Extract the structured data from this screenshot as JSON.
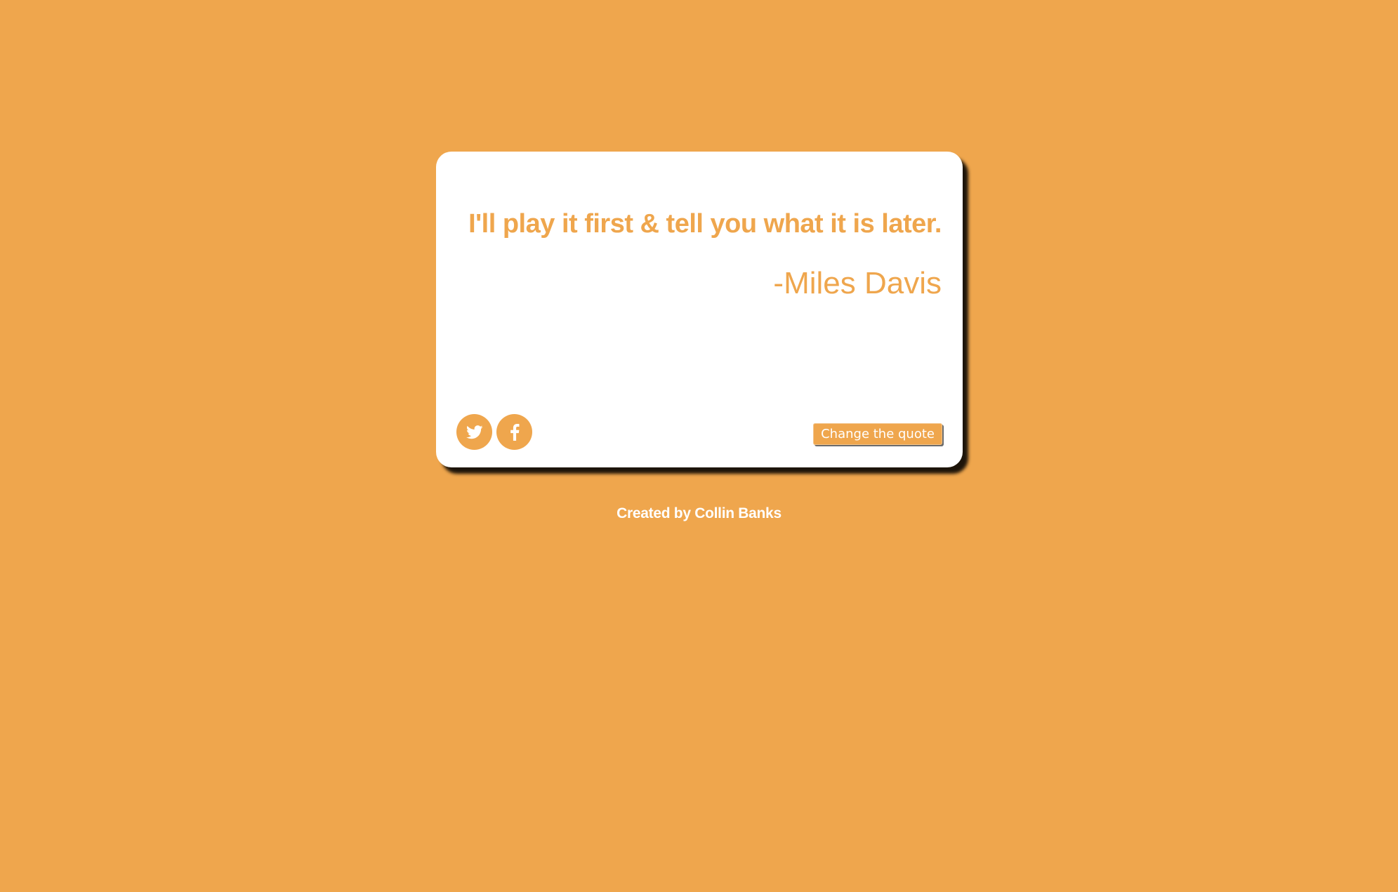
{
  "colors": {
    "background": "#EFA64D",
    "card": "#FFFFFF",
    "accent": "#EFA64D",
    "button_text": "#FFFFFF"
  },
  "quote": {
    "text": "I'll play it first & tell you what it is later.",
    "author": "-Miles Davis"
  },
  "actions": {
    "social_icons": [
      "twitter-icon",
      "facebook-icon"
    ],
    "change_quote_label": "Change the quote"
  },
  "footer": {
    "credit": "Created by Collin Banks"
  }
}
